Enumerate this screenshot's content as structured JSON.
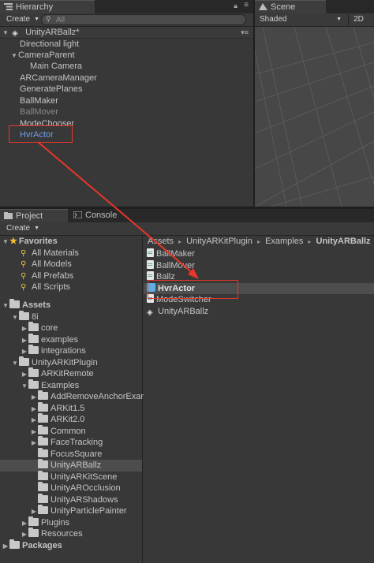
{
  "hierarchy": {
    "tab_label": "Hierarchy",
    "create_label": "Create",
    "search_placeholder": "All",
    "scene_title": "UnityARBallz*",
    "items": [
      {
        "label": "Directional light"
      },
      {
        "label": "CameraParent"
      },
      {
        "label": "Main Camera"
      },
      {
        "label": "ARCameraManager"
      },
      {
        "label": "GeneratePlanes"
      },
      {
        "label": "BallMaker"
      },
      {
        "label": "BallMover"
      },
      {
        "label": "ModeChooser"
      },
      {
        "label": "HvrActor"
      }
    ]
  },
  "scene": {
    "tab_label": "Scene",
    "shading_label": "Shaded",
    "mode_2d_label": "2D"
  },
  "project": {
    "tab_label": "Project",
    "console_tab_label": "Console",
    "create_label": "Create",
    "favorites_label": "Favorites",
    "favorites": [
      "All Materials",
      "All Models",
      "All Prefabs",
      "All Scripts"
    ],
    "assets_label": "Assets",
    "tree": [
      {
        "label": "8i"
      },
      {
        "label": "core"
      },
      {
        "label": "examples"
      },
      {
        "label": "integrations"
      },
      {
        "label": "UnityARKitPlugin"
      },
      {
        "label": "ARKitRemote"
      },
      {
        "label": "Examples"
      },
      {
        "label": "AddRemoveAnchorExar"
      },
      {
        "label": "ARKit1.5"
      },
      {
        "label": "ARKit2.0"
      },
      {
        "label": "Common"
      },
      {
        "label": "FaceTracking"
      },
      {
        "label": "FocusSquare"
      },
      {
        "label": "UnityARBallz"
      },
      {
        "label": "UnityARKitScene"
      },
      {
        "label": "UnityAROcclusion"
      },
      {
        "label": "UnityARShadows"
      },
      {
        "label": "UnityParticlePainter"
      },
      {
        "label": "Plugins"
      },
      {
        "label": "Resources"
      }
    ],
    "packages_label": "Packages",
    "breadcrumb": [
      "Assets",
      "UnityARKitPlugin",
      "Examples",
      "UnityARBallz"
    ],
    "breadcrumb_sep": "▸",
    "files": [
      {
        "label": "BallMaker",
        "icon": "script-icon"
      },
      {
        "label": "BallMover",
        "icon": "script-icon"
      },
      {
        "label": "Ballz",
        "icon": "script-icon"
      },
      {
        "label": "HvrActor",
        "icon": "prefab-icon"
      },
      {
        "label": "ModeSwitcher",
        "icon": "script-icon"
      },
      {
        "label": "UnityARBallz",
        "icon": "unity-scene-icon"
      }
    ]
  },
  "annotation": {
    "color": "#e8362a"
  }
}
